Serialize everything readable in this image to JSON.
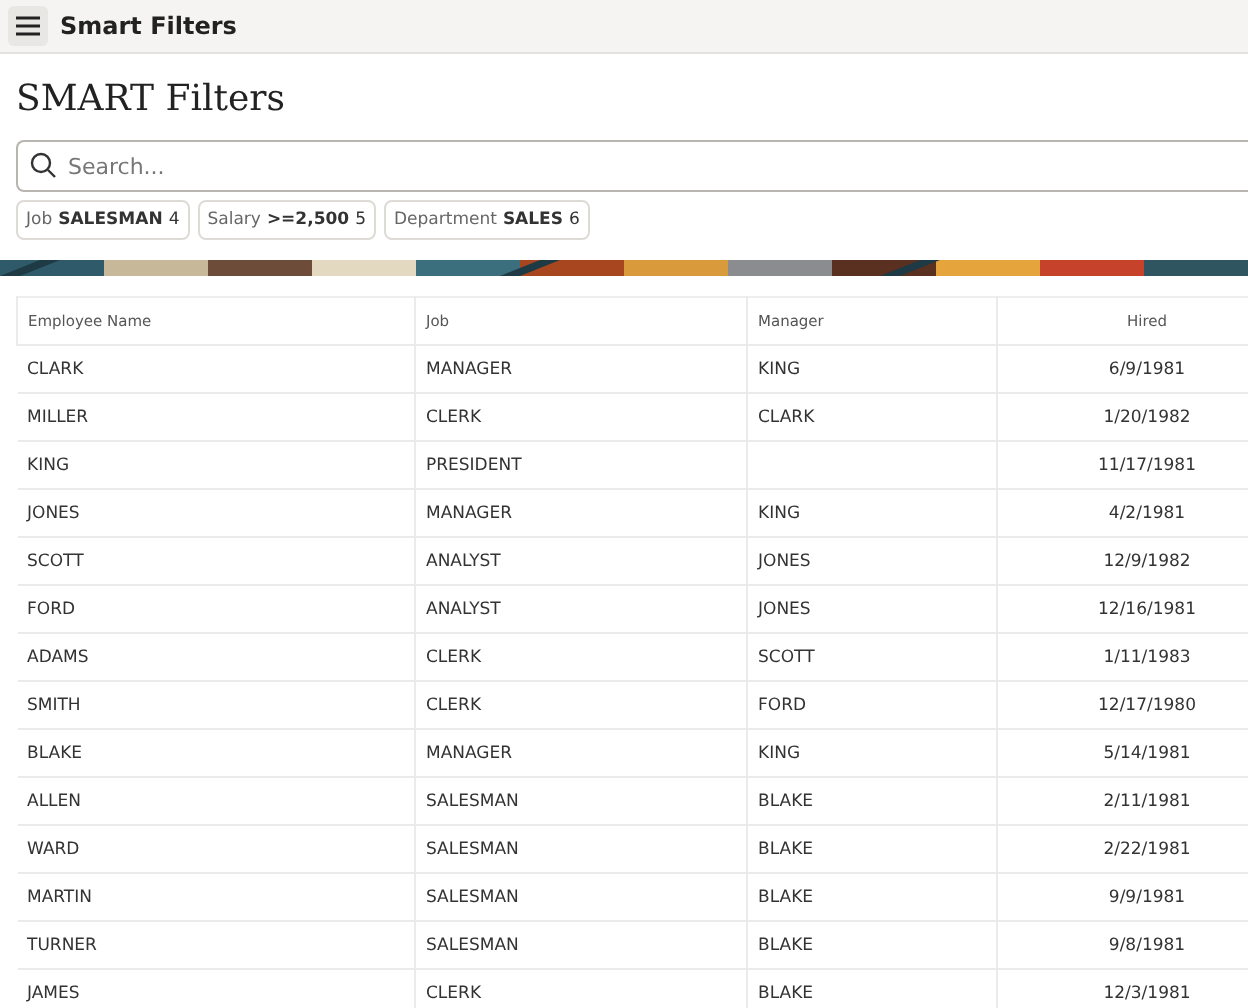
{
  "header": {
    "title": "Smart Filters"
  },
  "page_title": "SMART Filters",
  "search": {
    "placeholder": "Search..."
  },
  "filter_chips": [
    {
      "label": "Job",
      "value": "SALESMAN",
      "count": "4"
    },
    {
      "label": "Salary",
      "value": ">=2,500",
      "count": "5"
    },
    {
      "label": "Department",
      "value": "SALES",
      "count": "6"
    }
  ],
  "table": {
    "columns": [
      "Employee Name",
      "Job",
      "Manager",
      "Hired"
    ],
    "rows": [
      [
        "CLARK",
        "MANAGER",
        "KING",
        "6/9/1981"
      ],
      [
        "MILLER",
        "CLERK",
        "CLARK",
        "1/20/1982"
      ],
      [
        "KING",
        "PRESIDENT",
        "",
        "11/17/1981"
      ],
      [
        "JONES",
        "MANAGER",
        "KING",
        "4/2/1981"
      ],
      [
        "SCOTT",
        "ANALYST",
        "JONES",
        "12/9/1982"
      ],
      [
        "FORD",
        "ANALYST",
        "JONES",
        "12/16/1981"
      ],
      [
        "ADAMS",
        "CLERK",
        "SCOTT",
        "1/11/1983"
      ],
      [
        "SMITH",
        "CLERK",
        "FORD",
        "12/17/1980"
      ],
      [
        "BLAKE",
        "MANAGER",
        "KING",
        "5/14/1981"
      ],
      [
        "ALLEN",
        "SALESMAN",
        "BLAKE",
        "2/11/1981"
      ],
      [
        "WARD",
        "SALESMAN",
        "BLAKE",
        "2/22/1981"
      ],
      [
        "MARTIN",
        "SALESMAN",
        "BLAKE",
        "9/9/1981"
      ],
      [
        "TURNER",
        "SALESMAN",
        "BLAKE",
        "9/8/1981"
      ],
      [
        "JAMES",
        "CLERK",
        "BLAKE",
        "12/3/1981"
      ]
    ]
  }
}
